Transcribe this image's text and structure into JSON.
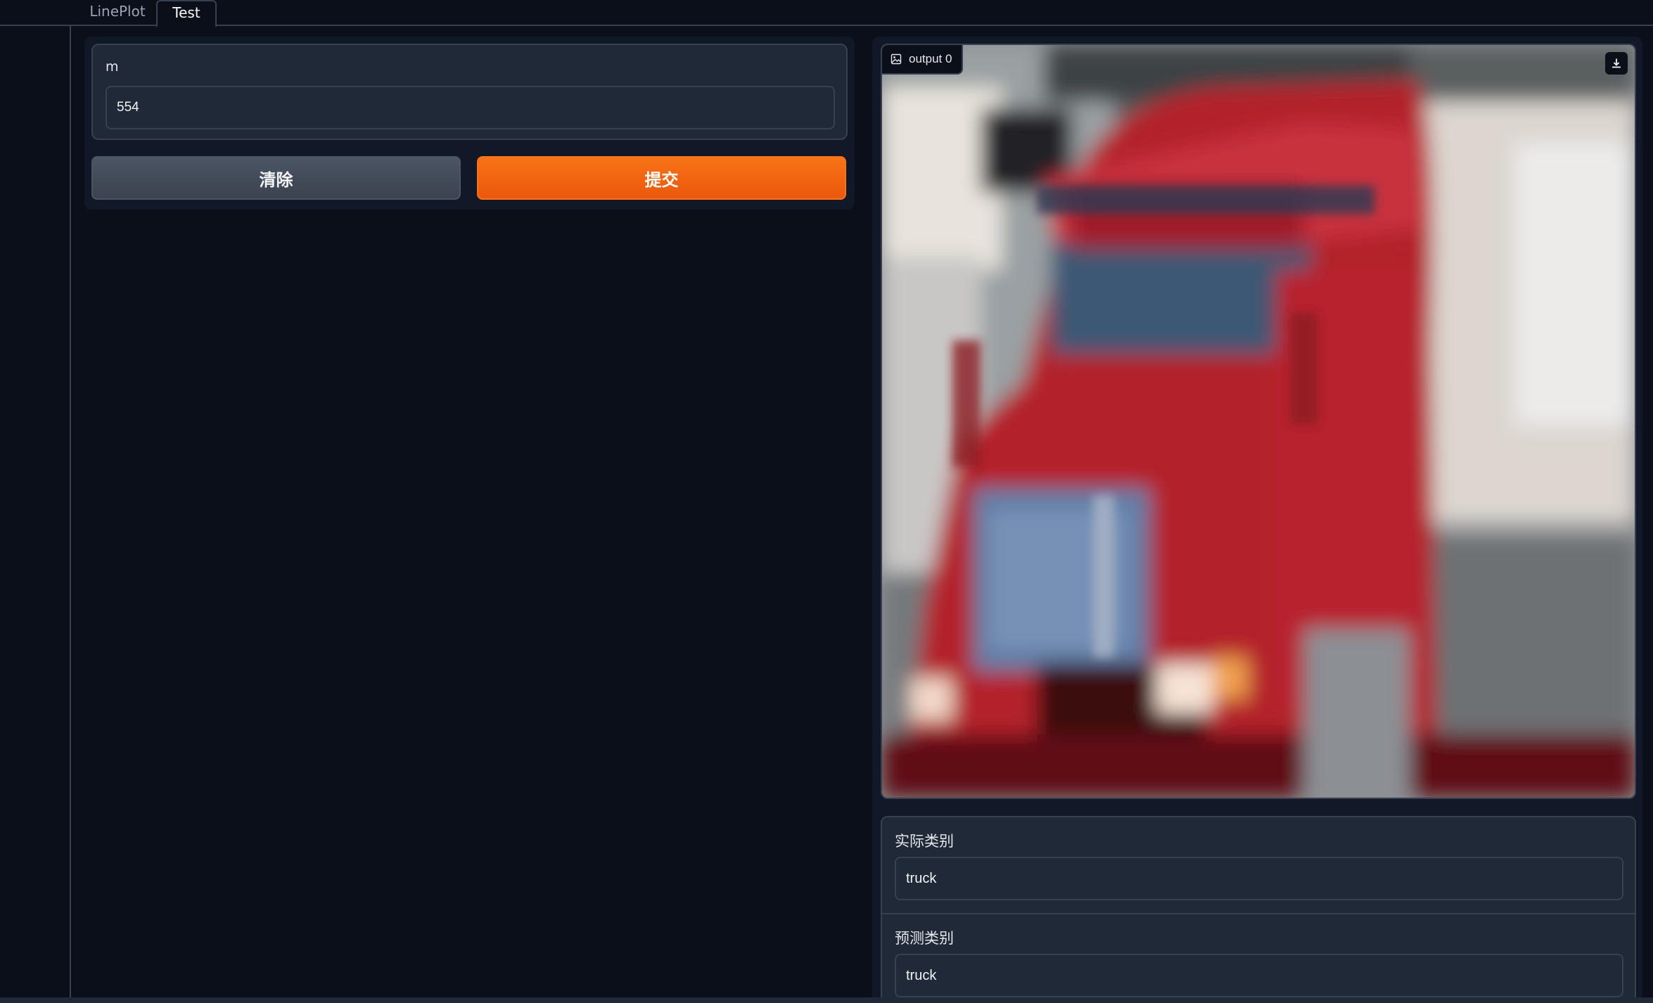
{
  "tabs": [
    {
      "label": "LinePlot"
    },
    {
      "label": "Test"
    }
  ],
  "input": {
    "label": "m",
    "value": "554"
  },
  "buttons": {
    "clear_label": "清除",
    "submit_label": "提交"
  },
  "output_image": {
    "label": "output 0",
    "icon": "image-icon",
    "download_icon": "download-icon"
  },
  "results": {
    "actual": {
      "label": "实际类别",
      "value": "truck"
    },
    "predicted": {
      "label": "预测类别",
      "value": "truck"
    }
  },
  "colors": {
    "background": "#0b0f19",
    "panel": "#1f2937",
    "border": "#374151",
    "primary_button": "#f97316",
    "secondary_button": "#4b5563"
  }
}
